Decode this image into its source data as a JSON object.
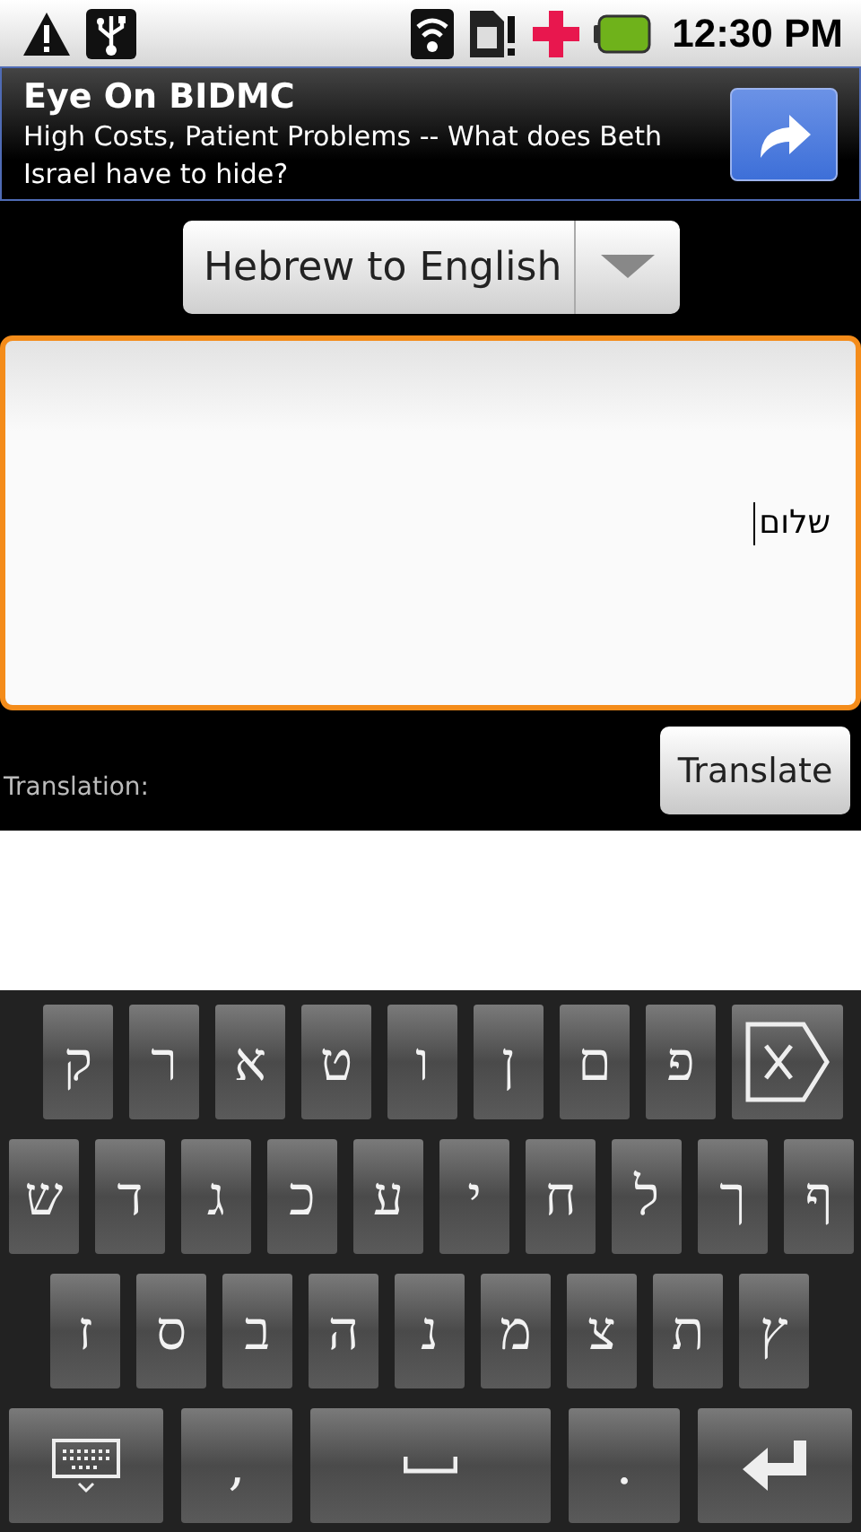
{
  "status_bar": {
    "time": "12:30 PM"
  },
  "ad": {
    "title": "Eye On BIDMC",
    "text": "High Costs, Patient Problems -- What does Beth Israel have to hide?"
  },
  "language_spinner": {
    "value": "Hebrew to English"
  },
  "input": {
    "value": "שלום"
  },
  "translation_label": "Translation:",
  "translate_button": "Translate",
  "keyboard": {
    "rows": [
      [
        {
          "kind": "char",
          "label": "ק"
        },
        {
          "kind": "char",
          "label": "ר"
        },
        {
          "kind": "char",
          "label": "א"
        },
        {
          "kind": "char",
          "label": "ט"
        },
        {
          "kind": "char",
          "label": "ו"
        },
        {
          "kind": "char",
          "label": "ן"
        },
        {
          "kind": "char",
          "label": "ם"
        },
        {
          "kind": "char",
          "label": "פ"
        },
        {
          "kind": "delete"
        }
      ],
      [
        {
          "kind": "char",
          "label": "ש"
        },
        {
          "kind": "char",
          "label": "ד"
        },
        {
          "kind": "char",
          "label": "ג"
        },
        {
          "kind": "char",
          "label": "כ"
        },
        {
          "kind": "char",
          "label": "ע"
        },
        {
          "kind": "char",
          "label": "י"
        },
        {
          "kind": "char",
          "label": "ח"
        },
        {
          "kind": "char",
          "label": "ל"
        },
        {
          "kind": "char",
          "label": "ך"
        },
        {
          "kind": "char",
          "label": "ף"
        }
      ],
      [
        {
          "kind": "char",
          "label": "ז"
        },
        {
          "kind": "char",
          "label": "ס"
        },
        {
          "kind": "char",
          "label": "ב"
        },
        {
          "kind": "char",
          "label": "ה"
        },
        {
          "kind": "char",
          "label": "נ"
        },
        {
          "kind": "char",
          "label": "מ"
        },
        {
          "kind": "char",
          "label": "צ"
        },
        {
          "kind": "char",
          "label": "ת"
        },
        {
          "kind": "char",
          "label": "ץ"
        }
      ],
      [
        {
          "kind": "keyboard"
        },
        {
          "kind": "char",
          "label": ","
        },
        {
          "kind": "space"
        },
        {
          "kind": "char",
          "label": "."
        },
        {
          "kind": "enter"
        }
      ]
    ]
  }
}
